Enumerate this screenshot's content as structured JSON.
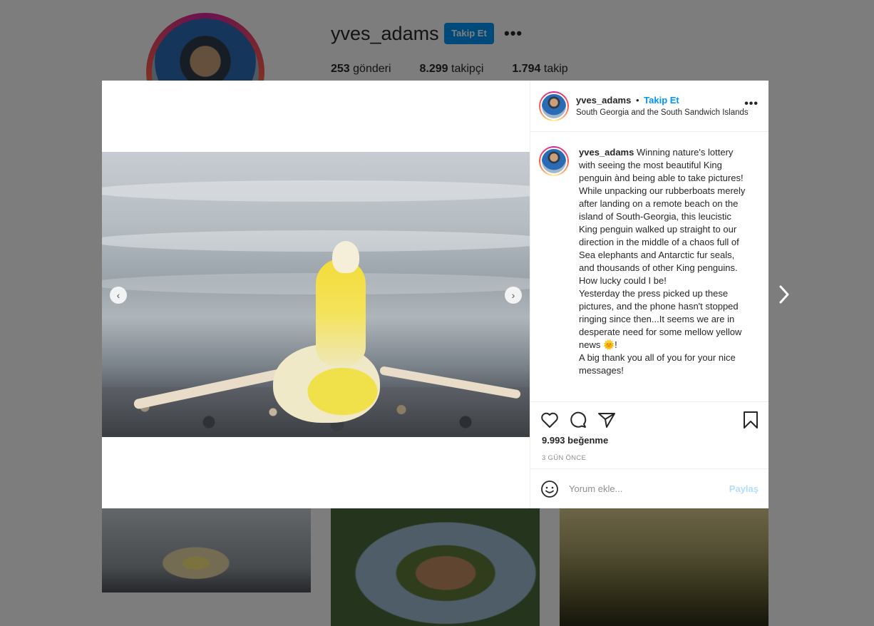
{
  "profile": {
    "username": "yves_adams",
    "follow_button": "Takip Et",
    "more": "•••",
    "stats": [
      {
        "count": "253",
        "label": "gönderi"
      },
      {
        "count": "8.299",
        "label": "takipçi"
      },
      {
        "count": "1.794",
        "label": "takip"
      }
    ]
  },
  "post": {
    "header": {
      "username": "yves_adams",
      "separator": "•",
      "follow_link": "Takip Et",
      "location": "South Georgia and the South Sandwich Islands",
      "more": "•••"
    },
    "caption": {
      "username": "yves_adams",
      "text": "Winning nature's lottery with seeing the most beautiful King penguin ànd being able to take pictures! While unpacking our rubberboats merely after landing on a remote beach on the island of South-Georgia, this leucistic King penguin walked up straight to our direction in the middle of a chaos full of Sea elephants and Antarctic fur seals, and thousands of other King penguins. How lucky could I be!\nYesterday the press picked up these pictures, and the phone hasn't stopped ringing since then...It seems we are in desperate need for some mellow yellow news 🌞!\nA big thank you all of you for your nice messages!"
    },
    "likes": "9.993 beğenme",
    "time": "3 GÜN ÖNCE",
    "comment": {
      "placeholder": "Yorum ekle...",
      "share": "Paylaş"
    }
  },
  "icons": {
    "prev": "chevron-left-icon",
    "next": "chevron-right-icon",
    "like": "heart-icon",
    "comment": "comment-icon",
    "share": "paper-plane-icon",
    "save": "bookmark-icon",
    "emoji": "smiley-icon"
  },
  "colors": {
    "accent": "#0095f6",
    "share_disabled": "#b2dffc",
    "muted": "#8e8e8e"
  }
}
